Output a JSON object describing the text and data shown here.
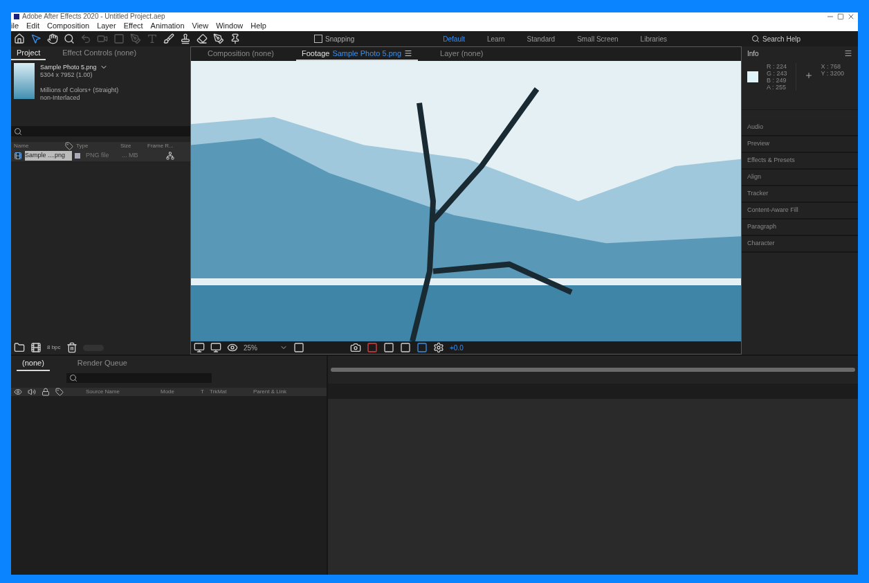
{
  "window": {
    "title": "Adobe After Effects 2020 - Untitled Project.aep"
  },
  "menu": [
    "ile",
    "Edit",
    "Composition",
    "Layer",
    "Effect",
    "Animation",
    "View",
    "Window",
    "Help"
  ],
  "toolbar": {
    "snapping": {
      "label": "Snapping",
      "checked": false
    }
  },
  "workspaces": [
    {
      "label": "Default",
      "selected": true
    },
    {
      "label": "Learn",
      "selected": false
    },
    {
      "label": "Standard",
      "selected": false
    },
    {
      "label": "Small Screen",
      "selected": false
    },
    {
      "label": "Libraries",
      "selected": false
    }
  ],
  "search_help": {
    "placeholder": "Search Help"
  },
  "project_panel": {
    "tabs": [
      {
        "label": "Project",
        "selected": true
      },
      {
        "label": "Effect Controls (none)",
        "selected": false
      }
    ],
    "preview": {
      "name": "Sample Photo 5.png",
      "lines": [
        "5304 x 7952 (1.00)",
        "Millions of Colors+ (Straight)",
        "non-Interlaced"
      ]
    },
    "columns": [
      "Name",
      "Type",
      "Size",
      "Frame R..."
    ],
    "rows": [
      {
        "name": "Sample ....png",
        "type": "PNG file",
        "size": "... MB",
        "selected": true
      }
    ],
    "bit_depth": "8 bpc"
  },
  "viewer": {
    "tabs": [
      {
        "label": "Composition (none)",
        "selected": false
      },
      {
        "label": "Sample Photo 5.png",
        "prefix": "Footage",
        "selected": true
      },
      {
        "label": "Layer (none)",
        "selected": false
      }
    ],
    "zoom": "25%",
    "exposure": "+0.0"
  },
  "info_panel": {
    "title": "Info",
    "channels": [
      "R : 224",
      "G : 243",
      "B : 249",
      "A : 255"
    ],
    "coords": [
      "X : 768",
      "Y : 3200"
    ],
    "color": "#e0f3f9"
  },
  "side_panels": [
    "Audio",
    "Preview",
    "Effects & Presets",
    "Align",
    "Tracker",
    "Content-Aware Fill",
    "Paragraph",
    "Character"
  ],
  "timeline": {
    "tabs": [
      {
        "label": "(none)",
        "selected": true
      },
      {
        "label": "Render Queue",
        "selected": false
      }
    ],
    "columns": [
      "Source Name",
      "Mode",
      "T",
      "TrkMat",
      "Parent & Link"
    ]
  }
}
